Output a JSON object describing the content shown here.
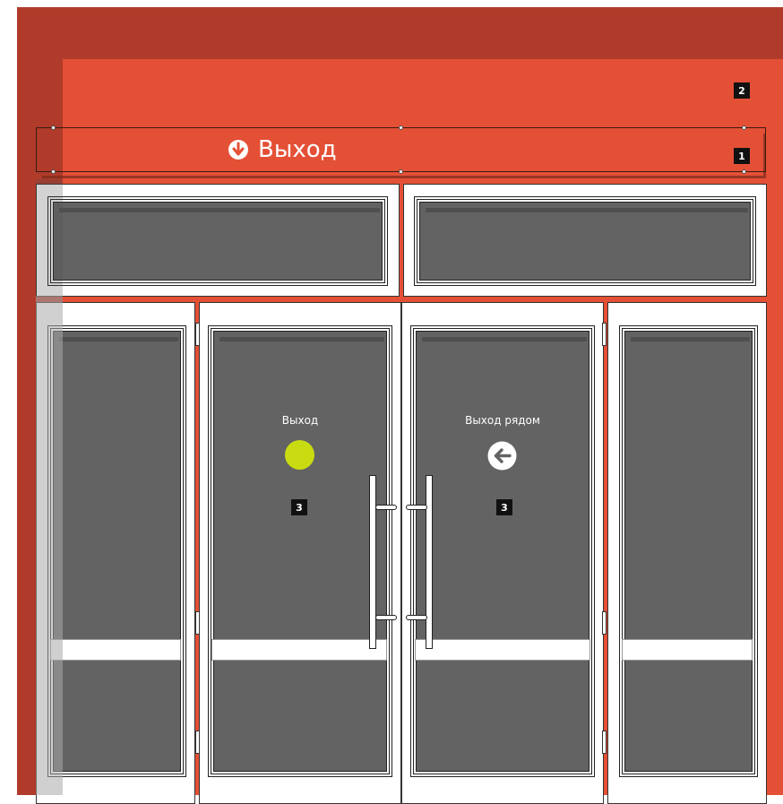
{
  "sign": {
    "text": "Выход",
    "icon": "down-arrow-circle-icon"
  },
  "tags": {
    "sign_tag": "1",
    "facade_tag": "2",
    "door_left_tag": "3",
    "door_right_tag": "3"
  },
  "doors": {
    "left_label": "Выход",
    "right_label": "Выход рядом",
    "left_marker_color": "#c8dc11",
    "right_icon": "left-arrow-circle-icon"
  },
  "colors": {
    "facade": "#e45036",
    "facade_shade": "#b03b2a",
    "glass": "#636363"
  }
}
